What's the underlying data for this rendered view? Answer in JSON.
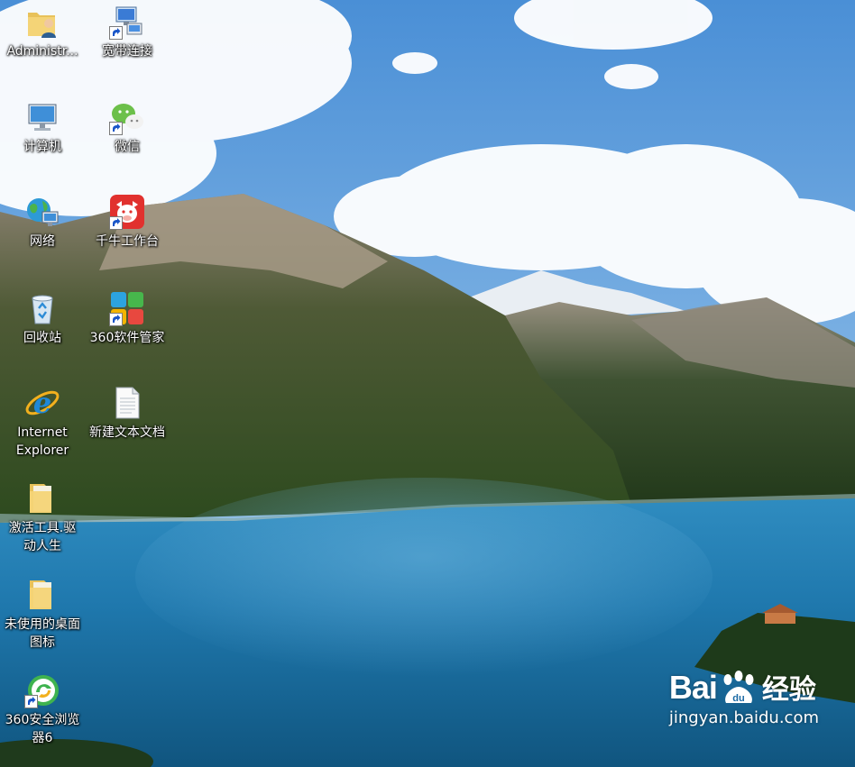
{
  "desktop": {
    "icons": [
      {
        "name": "administrator-folder-icon",
        "label": "Administr..."
      },
      {
        "name": "broadband-connection-icon",
        "label": "宽带连接"
      },
      {
        "name": "computer-icon",
        "label": "计算机"
      },
      {
        "name": "wechat-icon",
        "label": "微信"
      },
      {
        "name": "network-icon",
        "label": "网络"
      },
      {
        "name": "qianniu-icon",
        "label": "千牛工作台"
      },
      {
        "name": "recycle-bin-icon",
        "label": "回收站"
      },
      {
        "name": "360-software-manager-icon",
        "label": "360软件管家"
      },
      {
        "name": "internet-explorer-icon",
        "label": "Internet\nExplorer"
      },
      {
        "name": "new-text-document-icon",
        "label": "新建文本文档"
      },
      {
        "name": "activation-tools-folder-icon",
        "label": "激活工具.驱\n动人生"
      },
      {
        "name": "unused-desktop-icons-folder-icon",
        "label": "未使用的桌面\n图标"
      },
      {
        "name": "360-browser-icon",
        "label": "360安全浏览\n器6"
      }
    ]
  },
  "watermark": {
    "brand_left": "Bai",
    "brand_du": "du",
    "brand_cn": "经验",
    "url": "jingyan.baidu.com"
  }
}
